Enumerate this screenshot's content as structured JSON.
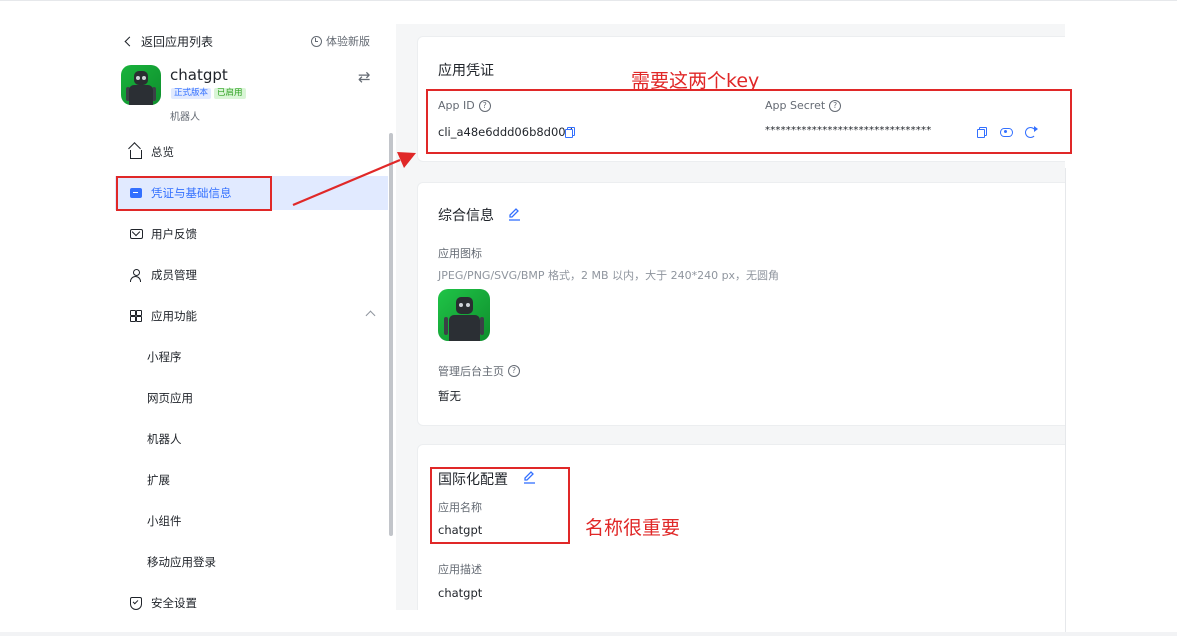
{
  "sidebar": {
    "back_label": "返回应用列表",
    "try_new_label": "体验新版",
    "app": {
      "name": "chatgpt",
      "tag_version": "正式版本",
      "tag_status": "已启用",
      "type": "机器人"
    },
    "items": [
      {
        "label": "总览",
        "icon": "home-icon"
      },
      {
        "label": "凭证与基础信息",
        "icon": "credential-card-icon",
        "active": true
      },
      {
        "label": "用户反馈",
        "icon": "mail-icon"
      },
      {
        "label": "成员管理",
        "icon": "user-icon"
      },
      {
        "label": "应用功能",
        "icon": "grid-icon",
        "expanded": true
      }
    ],
    "sub_items": [
      "小程序",
      "网页应用",
      "机器人",
      "扩展",
      "小组件",
      "移动应用登录"
    ],
    "last_item": {
      "label": "安全设置",
      "icon": "shield-icon"
    }
  },
  "credentials": {
    "title": "应用凭证",
    "app_id_label": "App ID",
    "app_id_value": "cli_a48e6ddd06b8d00d",
    "app_secret_label": "App Secret",
    "app_secret_value": "********************************"
  },
  "general": {
    "title": "综合信息",
    "icon_label": "应用图标",
    "icon_hint": "JPEG/PNG/SVG/BMP 格式，2 MB 以内，大于 240*240 px，无圆角",
    "admin_home_label": "管理后台主页",
    "admin_home_value": "暂无"
  },
  "i18n": {
    "title": "国际化配置",
    "name_label": "应用名称",
    "name_value": "chatgpt",
    "desc_label": "应用描述",
    "desc_value": "chatgpt"
  },
  "annotations": {
    "need_keys": "需要这两个key",
    "name_important": "名称很重要"
  },
  "colors": {
    "accent": "#3370ff",
    "annotation": "#e02828",
    "active_bg": "#e1eaff"
  }
}
